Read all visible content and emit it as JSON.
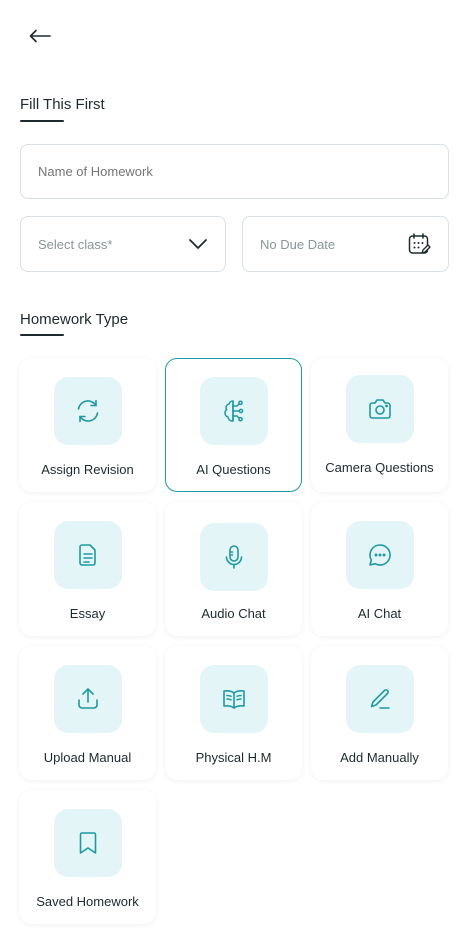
{
  "header": {
    "back_icon": "arrow-left-icon"
  },
  "form_section": {
    "title": "Fill This First",
    "homework_name": {
      "placeholder": "Name of Homework",
      "value": ""
    },
    "class_select": {
      "placeholder": "Select class*",
      "icon": "chevron-down-icon"
    },
    "due_date": {
      "placeholder": "No Due Date",
      "icon": "calendar-edit-icon"
    }
  },
  "type_section": {
    "title": "Homework Type",
    "selected": "AI Questions",
    "items": [
      {
        "label": "Assign Revision",
        "icon": "refresh-icon"
      },
      {
        "label": "AI Questions",
        "icon": "brain-circuit-icon"
      },
      {
        "label": "Camera Questions",
        "icon": "camera-icon"
      },
      {
        "label": "Essay",
        "icon": "document-icon"
      },
      {
        "label": "Audio Chat",
        "icon": "microphone-icon"
      },
      {
        "label": "AI Chat",
        "icon": "chat-bubble-icon"
      },
      {
        "label": "Upload Manual",
        "icon": "upload-icon"
      },
      {
        "label": "Physical H.M",
        "icon": "open-book-icon"
      },
      {
        "label": "Add Manually",
        "icon": "pencil-icon"
      },
      {
        "label": "Saved Homework",
        "icon": "bookmark-icon"
      }
    ]
  },
  "colors": {
    "accent": "#1d9aa3",
    "icon_bg": "#e3f5f6",
    "border": "#d9dfe2"
  }
}
